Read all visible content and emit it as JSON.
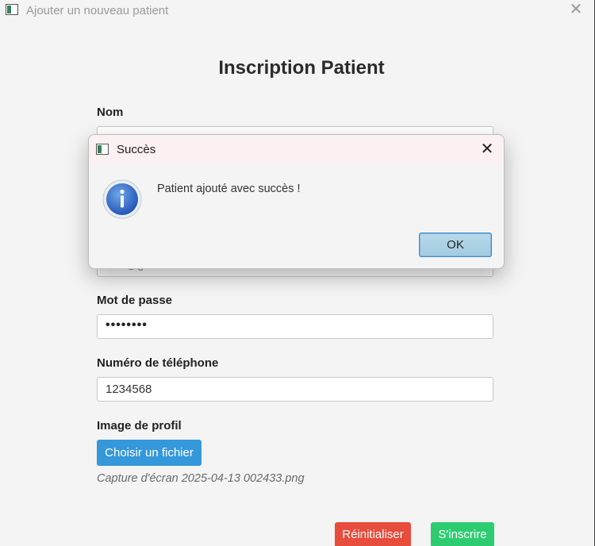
{
  "window": {
    "title": "Ajouter un nouveau patient",
    "close_glyph": "✕"
  },
  "form": {
    "heading": "Inscription Patient",
    "nom_label": "Nom",
    "email_value_partial": "uuu@gmail.com",
    "password_label": "Mot de passe",
    "password_value": "••••••••",
    "phone_label": "Numéro de téléphone",
    "phone_value": "1234568",
    "image_label": "Image de profil",
    "choose_file_label": "Choisir un fichier",
    "file_name": "Capture d'écran 2025-04-13 002433.png",
    "reset_label": "Réinitialiser",
    "submit_label": "S'inscrire"
  },
  "dialog": {
    "title": "Succès",
    "close_glyph": "✕",
    "message": "Patient ajouté avec succès !",
    "ok_label": "OK",
    "icon": "info-icon"
  },
  "colors": {
    "choose_button": "#3498db",
    "reset_button": "#e74c3c",
    "submit_button": "#2ecc71",
    "ok_button": "#a3cbe0"
  }
}
